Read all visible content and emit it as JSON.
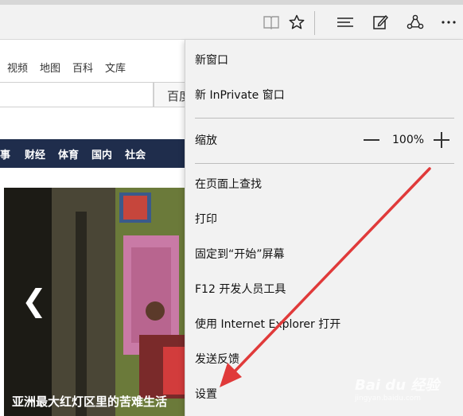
{
  "toolbar": {
    "icons": [
      "reading-view-icon",
      "favorite-star-icon",
      "hub-icon",
      "web-note-icon",
      "share-icon",
      "more-icon"
    ]
  },
  "page": {
    "nav_links": [
      "视频",
      "地图",
      "百科",
      "文库"
    ],
    "search_button": "百度一下",
    "news_nav": [
      "军事",
      "财经",
      "体育",
      "国内",
      "社会"
    ],
    "carousel_prev": "❮",
    "caption": "亚洲最大红灯区里的苦难生活"
  },
  "menu": {
    "new_window": "新窗口",
    "new_inprivate": "新 InPrivate 窗口",
    "zoom_label": "缩放",
    "zoom_value": "100%",
    "find_on_page": "在页面上查找",
    "print": "打印",
    "pin_to_start": "固定到“开始”屏幕",
    "f12_tools": "F12 开发人员工具",
    "open_with_ie": "使用 Internet Explorer 打开",
    "send_feedback": "发送反馈",
    "settings": "设置"
  },
  "watermark": {
    "brand": "Bai du 经验",
    "url": "jingyan.baidu.com"
  },
  "colors": {
    "menu_bg": "#f2f2f2",
    "news_nav_bg": "#1f2d4c",
    "arrow": "#e03a3a"
  }
}
